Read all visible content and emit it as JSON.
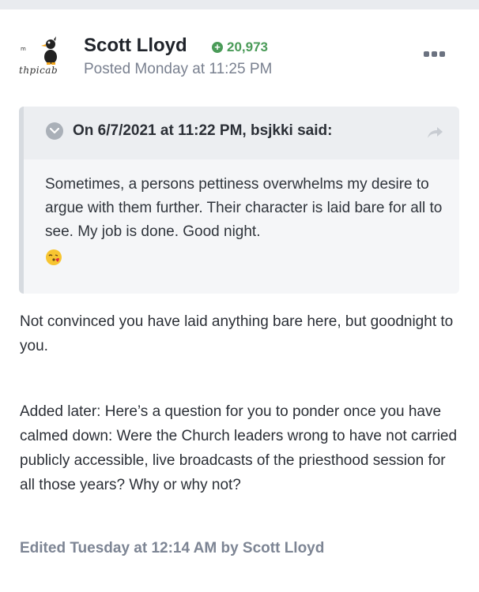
{
  "post": {
    "author": "Scott Lloyd",
    "reputation": "20,973",
    "posted": "Posted Monday at 11:25 PM",
    "avatar_text": "thpicab",
    "quote": {
      "citation": "On 6/7/2021 at 11:22 PM, bsjkki said:",
      "body": "Sometimes, a persons pettiness overwhelms my desire to argue with them further. Their character is laid bare for all to see. My job is done. Good night.",
      "emoji": "face-blowing-a-kiss"
    },
    "paragraphs": [
      "Not convinced you have laid anything bare here, but goodnight to you.",
      "Added later: Here’s a question for you to ponder once you have calmed down: Were the Church leaders wrong to have not carried publicly accessible, live broadcasts of the priesthood session for all those years? Why or why not?"
    ],
    "edited": "Edited Tuesday at 12:14 AM by Scott Lloyd"
  },
  "colors": {
    "reputation": "#4a9b58",
    "muted": "#7a8190",
    "quote_bg": "#f5f6f8",
    "quote_head_bg": "#eceef1"
  },
  "icons": {
    "more": "ellipsis-icon",
    "toggle": "chevron-down-circle-icon",
    "share": "share-arrow-icon",
    "rep": "plus-circle-icon"
  }
}
